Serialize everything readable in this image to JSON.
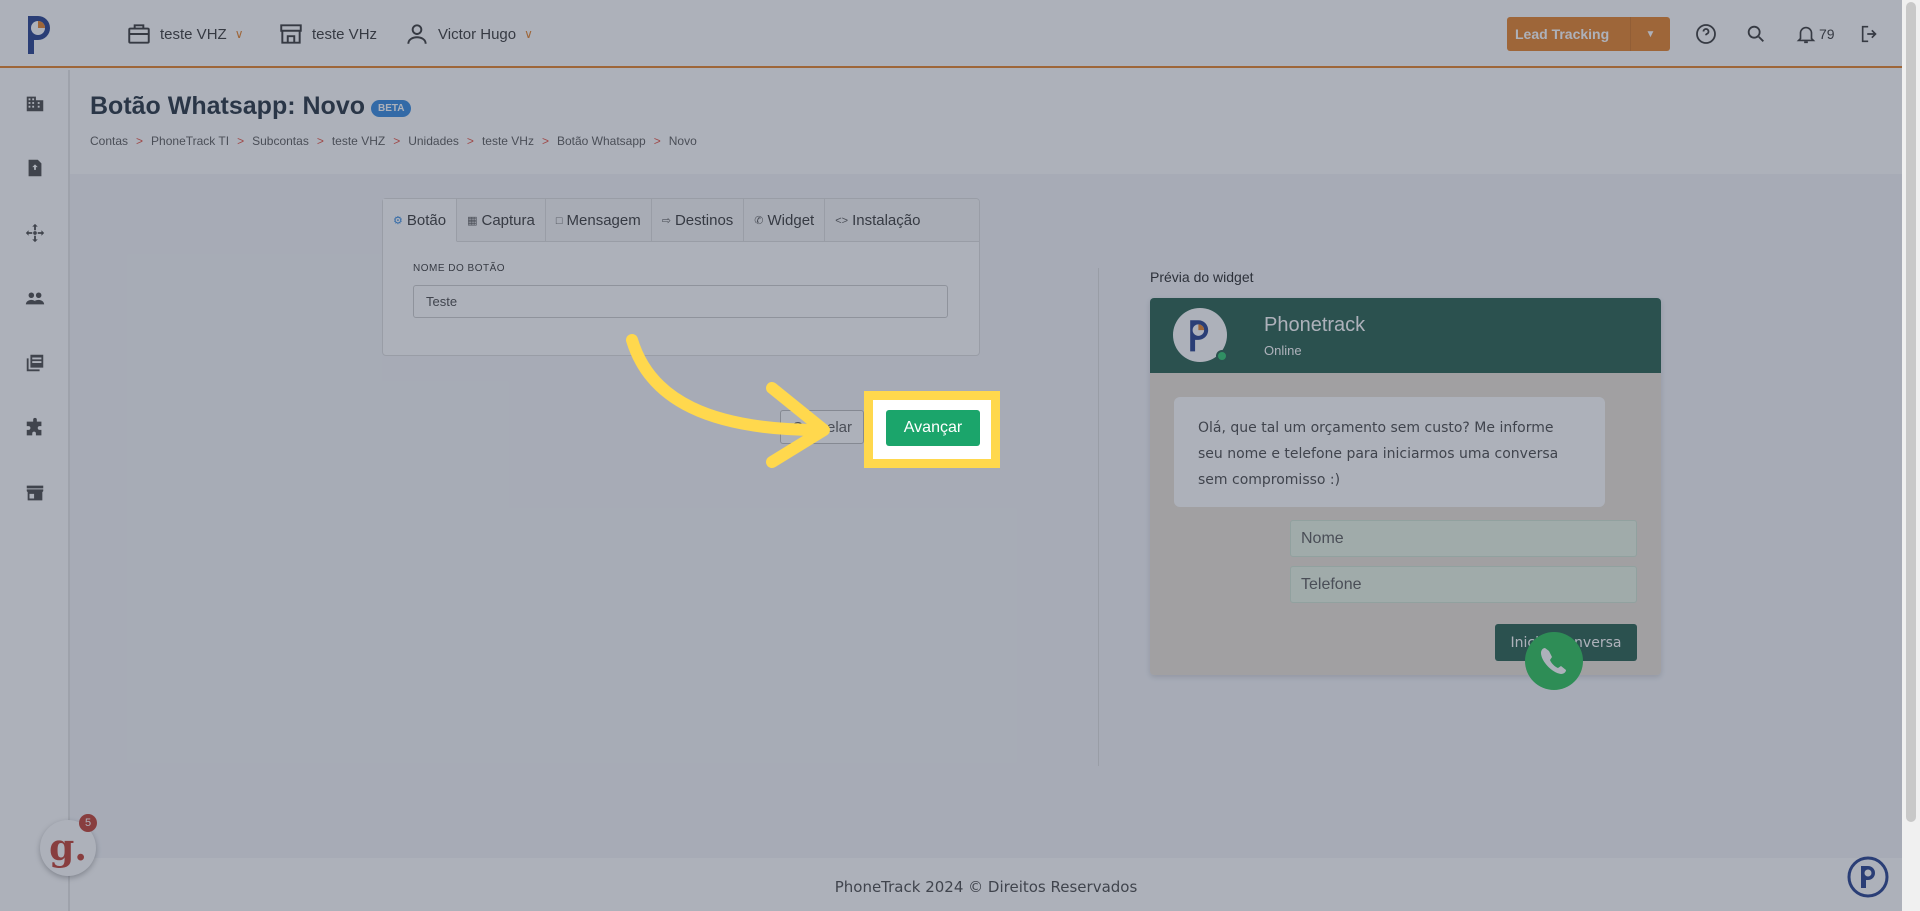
{
  "topbar": {
    "account": "teste VHZ",
    "store": "teste VHz",
    "user": "Victor Hugo",
    "lead_tracking": "Lead Tracking",
    "notifications": "79"
  },
  "page": {
    "title": "Botão Whatsapp: Novo",
    "badge": "BETA",
    "breadcrumb": [
      "Contas",
      "PhoneTrack TI",
      "Subcontas",
      "teste VHZ",
      "Unidades",
      "teste VHz",
      "Botão Whatsapp",
      "Novo"
    ],
    "breadcrumb_sep": ">"
  },
  "tabs": [
    {
      "label": "Botão",
      "icon": "gear-icon"
    },
    {
      "label": "Captura",
      "icon": "grid-icon"
    },
    {
      "label": "Mensagem",
      "icon": "message-icon"
    },
    {
      "label": "Destinos",
      "icon": "login-icon"
    },
    {
      "label": "Widget",
      "icon": "whatsapp-icon"
    },
    {
      "label": "Instalação",
      "icon": "code-icon"
    }
  ],
  "form": {
    "field_label": "NOME DO BOTÃO",
    "field_value": "Teste",
    "cancel": "Cancelar",
    "advance": "Avançar"
  },
  "preview": {
    "label": "Prévia do widget",
    "name": "Phonetrack",
    "status": "Online",
    "message": "Olá, que tal um orçamento sem custo? Me informe seu nome e telefone para iniciarmos uma conversa sem compromisso :)",
    "name_placeholder": "Nome",
    "phone_placeholder": "Telefone",
    "start_button": "Iniciar conversa"
  },
  "footer": "PhoneTrack 2024 © Direitos Reservados",
  "badges": {
    "g_count": "5"
  },
  "colors": {
    "accent": "#e67e22",
    "whatsapp_green": "#1f5a48",
    "advance_green": "#1ba56b",
    "highlight": "#ffd84d"
  }
}
